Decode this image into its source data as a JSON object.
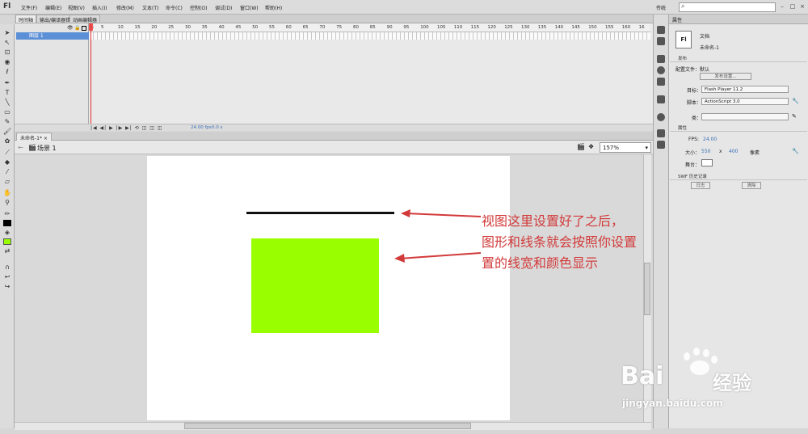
{
  "app": {
    "logo": "Fl"
  },
  "menu": [
    "文件(F)",
    "编辑(E)",
    "视图(V)",
    "插入(I)",
    "修改(M)",
    "文本(T)",
    "命令(C)",
    "控制(O)",
    "调试(D)",
    "窗口(W)",
    "帮助(H)"
  ],
  "workspace": "传统",
  "search": {
    "placeholder": ""
  },
  "timeline": {
    "tabs": [
      "时间轴",
      "输出/编译器错误",
      "动画编辑器"
    ],
    "layer_name": "图层 1",
    "frame_numbers": [
      "1",
      "5",
      "10",
      "15",
      "20",
      "25",
      "30",
      "35",
      "40",
      "45",
      "50",
      "55",
      "60",
      "65",
      "70",
      "75",
      "80",
      "85",
      "90",
      "95",
      "100",
      "105",
      "110",
      "115",
      "120",
      "125",
      "130",
      "135",
      "140",
      "145",
      "150",
      "155",
      "160",
      "16"
    ],
    "fps": "24.00 fps",
    "time": "0.0 s"
  },
  "document": {
    "tab_label": "未命名-1*",
    "scene": "场景 1",
    "zoom": "157%"
  },
  "annotation": {
    "text": "视图这里设置好了之后，\n图形和线条就会按照你设置\n置的线宽和颜色显示"
  },
  "shapes": {
    "line_color": "#111111",
    "rect_color": "#99ff00"
  },
  "properties": {
    "header": "属性",
    "doc_type": "文档",
    "doc_name": "未命名-1",
    "doc_icon": "Fl",
    "publish_section": "发布",
    "profile_label": "配置文件：",
    "profile_value": "默认",
    "publish_settings_btn": "发布设置...",
    "target_label": "目标：",
    "target_value": "Flash Player 11.2",
    "script_label": "脚本：",
    "script_value": "ActionScript 3.0",
    "class_label": "类：",
    "props_section": "属性",
    "fps_label": "FPS:",
    "fps_value": "24.00",
    "size_label": "大小：",
    "width": "550",
    "x_sep": "x",
    "height": "400",
    "unit": "像素",
    "stage_label": "舞台：",
    "history_section": "SWF 历史记录",
    "log_btn": "日志",
    "clear_btn": "清除"
  },
  "watermark": {
    "brand_line1": "Bai",
    "brand_line2": "经验",
    "url": "jingyan.baidu.com"
  }
}
